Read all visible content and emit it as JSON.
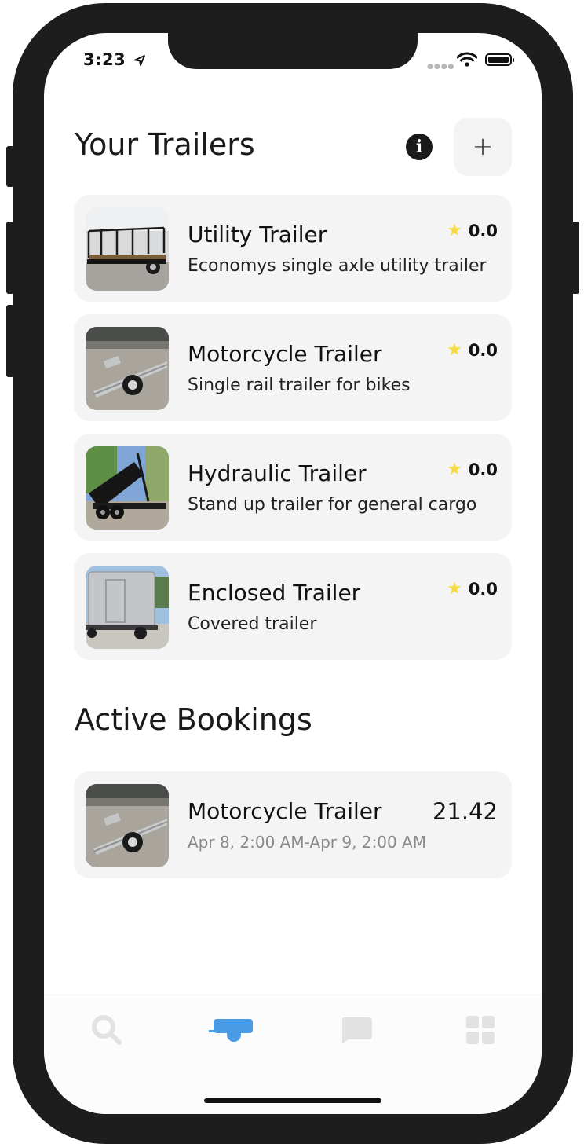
{
  "status_bar": {
    "time": "3:23"
  },
  "trailers_section": {
    "title": "Your Trailers",
    "info_icon": "info-icon",
    "add_label": "+"
  },
  "trailers": [
    {
      "title": "Utility Trailer",
      "description": "Economys single axle utility trailer",
      "rating": "0.0"
    },
    {
      "title": "Motorcycle Trailer",
      "description": "Single rail trailer for bikes",
      "rating": "0.0"
    },
    {
      "title": "Hydraulic Trailer",
      "description": "Stand up trailer for general cargo",
      "rating": "0.0"
    },
    {
      "title": "Enclosed Trailer",
      "description": "Covered trailer",
      "rating": "0.0"
    }
  ],
  "bookings_section": {
    "title": "Active Bookings"
  },
  "bookings": [
    {
      "title": "Motorcycle Trailer",
      "dates": "Apr 8, 2:00 AM-Apr 9, 2:00 AM",
      "price": "21.42"
    }
  ],
  "tabs": [
    {
      "icon": "search-icon",
      "active": false
    },
    {
      "icon": "trailer-icon",
      "active": true
    },
    {
      "icon": "chat-icon",
      "active": false
    },
    {
      "icon": "grid-icon",
      "active": false
    }
  ],
  "colors": {
    "accent": "#4a9be5",
    "star": "#f7da45",
    "card_bg": "#f4f4f4",
    "inactive_tab": "#e2e2e2"
  }
}
